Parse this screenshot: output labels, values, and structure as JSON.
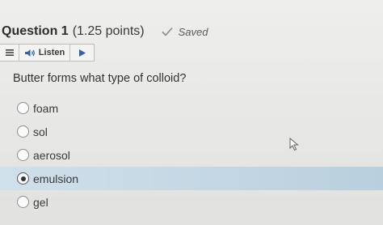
{
  "question": {
    "title": "Question 1",
    "points": "(1.25 points)",
    "status": "Saved",
    "text": "Butter forms what type of colloid?"
  },
  "toolbar": {
    "listen_label": "Listen",
    "menu_icon": "menu-icon",
    "speaker_icon": "speaker-icon",
    "play_icon": "play-icon"
  },
  "options": [
    {
      "label": "foam",
      "selected": false
    },
    {
      "label": "sol",
      "selected": false
    },
    {
      "label": "aerosol",
      "selected": false
    },
    {
      "label": "emulsion",
      "selected": true
    },
    {
      "label": "gel",
      "selected": false
    }
  ],
  "colors": {
    "selected_row": "#c3d6e3",
    "background": "#e9e9e7"
  }
}
